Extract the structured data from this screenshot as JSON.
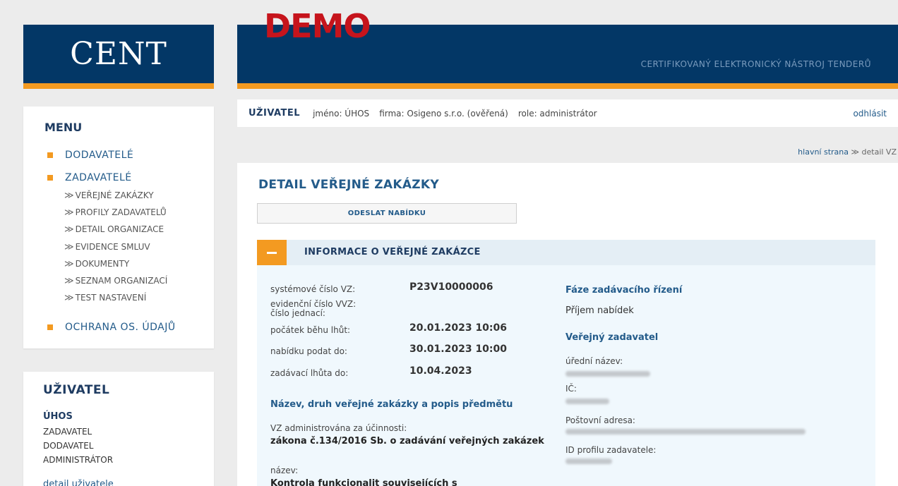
{
  "header": {
    "logo": "CENT",
    "demo": "DEMO",
    "subtitle": "CERTIFIKOVANÝ ELEKTRONICKÝ NÁSTROJ TENDERŮ"
  },
  "menu": {
    "title": "MENU",
    "items": [
      {
        "label": "DODAVATELÉ"
      },
      {
        "label": "ZADAVATELÉ"
      }
    ],
    "sub_items": [
      {
        "label": "VEŘEJNÉ ZAKÁZKY"
      },
      {
        "label": "PROFILY ZADAVATELŮ"
      },
      {
        "label": "DETAIL ORGANIZACE"
      },
      {
        "label": "EVIDENCE SMLUV"
      },
      {
        "label": "DOKUMENTY"
      },
      {
        "label": "SEZNAM ORGANIZACÍ"
      },
      {
        "label": "TEST NASTAVENÍ"
      }
    ],
    "privacy": "OCHRANA OS. ÚDAJŮ",
    "arrow": "≫"
  },
  "user_panel": {
    "title": "UŽIVATEL",
    "name": "ÚHOS",
    "roles": [
      "ZADAVATEL",
      "DODAVATEL",
      "ADMINISTRÁTOR"
    ],
    "detail_link": "detail uživatele"
  },
  "userbar": {
    "label": "UŽIVATEL",
    "name": "jméno: ÚHOS",
    "company": "firma: Osigeno s.r.o. (ověřená)",
    "role": "role: administrátor",
    "logout": "odhlásit"
  },
  "breadcrumb": {
    "home": "hlavní strana",
    "sep": "≫",
    "current": "detail VZ"
  },
  "main": {
    "title": "DETAIL VEŘEJNÉ ZAKÁZKY",
    "send_button": "ODESLAT NABÍDKU",
    "section_title": "INFORMACE O VEŘEJNÉ ZAKÁZCE",
    "fields": {
      "system_no_label": "systémové číslo VZ:",
      "system_no": "P23V10000006",
      "evid_label_1": "evidenční číslo VVZ:",
      "evid_label_2": "číslo jednací:",
      "start_label": "počátek běhu lhůt:",
      "start": "20.01.2023 10:06",
      "deadline_label": "nabídku podat do:",
      "deadline": "30.01.2023 10:00",
      "binding_label": "zadávací lhůta do:",
      "binding": "10.04.2023"
    },
    "subject": {
      "heading": "Název, druh veřejné zakázky a popis předmětu",
      "admin_label": "VZ administrována za účinnosti:",
      "law": "zákona č.134/2016 Sb. o zadávání veřejných zakázek",
      "name_label": "název:",
      "name": "Kontrola funkcionalit souvisejících s"
    },
    "phase": {
      "heading": "Fáze zadávacího řízení",
      "value": "Příjem nabídek"
    },
    "contracting": {
      "heading": "Veřejný zadavatel",
      "official_name_label": "úřední název:",
      "ic_label": "IČ:",
      "address_label": "Poštovní adresa:",
      "profile_label": "ID profilu zadavatele:"
    }
  }
}
